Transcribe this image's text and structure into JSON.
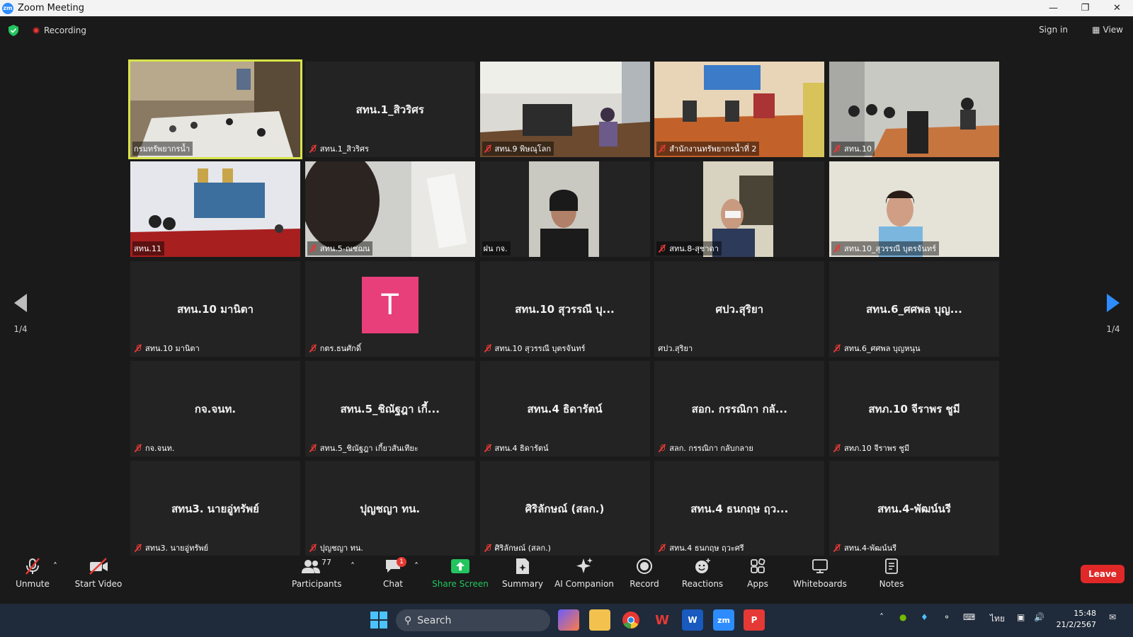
{
  "window": {
    "title": "Zoom Meeting",
    "controls": [
      "minimize",
      "restore",
      "close"
    ]
  },
  "meeting_bar": {
    "recording_label": "Recording",
    "sign_in": "Sign in",
    "view": "View"
  },
  "pagination": {
    "left": "1/4",
    "right": "1/4"
  },
  "tiles": [
    {
      "type": "video",
      "label": "กรมทรัพยากรน้ำ",
      "muted": false,
      "active": true,
      "scene": "room-wood"
    },
    {
      "type": "name",
      "center": "สทน.1_สิวริศร",
      "label": "สทน.1_สิวริศร",
      "muted": true
    },
    {
      "type": "video",
      "label": "สทน.9 พิษณุโลก",
      "muted": true,
      "scene": "office-white"
    },
    {
      "type": "video",
      "label": "สำนักงานทรัพยากรน้ำที่ 2",
      "muted": true,
      "scene": "room-orange"
    },
    {
      "type": "video",
      "label": "สทน.10",
      "muted": true,
      "scene": "room-grey"
    },
    {
      "type": "video",
      "label": "สทน.11",
      "muted": false,
      "scene": "room-red"
    },
    {
      "type": "video",
      "label": "สทน.5-ณชฌน",
      "muted": true,
      "scene": "closeup"
    },
    {
      "type": "video",
      "label": "ฝน กจ.",
      "muted": false,
      "scene": "portrait-narrow"
    },
    {
      "type": "video",
      "label": "สทน.8-สุชาดา",
      "muted": true,
      "scene": "portrait-window"
    },
    {
      "type": "video",
      "label": "สทน.10_สุวรรณี บุตรจันทร์",
      "muted": true,
      "scene": "portrait-blue"
    },
    {
      "type": "name",
      "center": "สทน.10 มานิตา",
      "label": "สทน.10 มานิตา",
      "muted": true
    },
    {
      "type": "avatar",
      "initial": "T",
      "label": "กตร.ธนศักดิ์",
      "muted": true
    },
    {
      "type": "name",
      "center": "สทน.10 สุวรรณี บุ...",
      "label": "สทน.10 สุวรรณี บุตรจันทร์",
      "muted": true
    },
    {
      "type": "name",
      "center": "ศปว.สุริยา",
      "label": "ศปว.สุริยา",
      "muted": false
    },
    {
      "type": "name",
      "center": "สทน.6_ศศพล บุญ...",
      "label": "สทน.6_ศศพล บุญหนุน",
      "muted": true
    },
    {
      "type": "name",
      "center": "กจ.จนท.",
      "label": "กจ.จนท.",
      "muted": true
    },
    {
      "type": "name",
      "center": "สทน.5_ชิณัฐฎา เกี้...",
      "label": "สทน.5_ชิณัฐฎา เกี้ยวสันเทียะ",
      "muted": true
    },
    {
      "type": "name",
      "center": "สทน.4 ธิดารัตน์",
      "label": "สทน.4 ธิดารัตน์",
      "muted": true
    },
    {
      "type": "name",
      "center": "สอก. กรรณิกา กลั...",
      "label": "สลก. กรรณิกา กลับกลาย",
      "muted": true
    },
    {
      "type": "name",
      "center": "สทภ.10 จีราพร ชูมี",
      "label": "สทภ.10 จีราพร ชูมี",
      "muted": true
    },
    {
      "type": "name",
      "center": "สทน3. นายอู่ทรัพย์",
      "label": "สทน3. นายอู่ทรัพย์",
      "muted": true
    },
    {
      "type": "name",
      "center": "ปุญชญา ทน.",
      "label": "ปุญชญา ทน.",
      "muted": true
    },
    {
      "type": "name",
      "center": "ศิริลักษณ์ (สลก.)",
      "label": "ศิริลักษณ์ (สลก.)",
      "muted": true
    },
    {
      "type": "name",
      "center": "สทน.4 ธนกฤษ ฤว...",
      "label": "สทน.4 ธนกฤษ ฤวะศรี",
      "muted": true
    },
    {
      "type": "name",
      "center": "สทน.4-พัฒน์นรี",
      "label": "สทน.4-พัฒน์นรี",
      "muted": true
    }
  ],
  "toolbar": {
    "unmute": "Unmute",
    "start_video": "Start Video",
    "participants": "Participants",
    "participants_count": "77",
    "chat": "Chat",
    "chat_badge": "1",
    "share_screen": "Share Screen",
    "summary": "Summary",
    "ai_companion": "AI Companion",
    "record": "Record",
    "reactions": "Reactions",
    "apps": "Apps",
    "whiteboards": "Whiteboards",
    "notes": "Notes",
    "leave": "Leave"
  },
  "taskbar": {
    "search_placeholder": "Search",
    "language": "ไทย",
    "time": "15:48",
    "date": "21/2/2567"
  },
  "colors": {
    "accent_green": "#22c55e",
    "leave_red": "#e02828",
    "active_speaker": "#d8e34a",
    "avatar_pink": "#e83e7a"
  }
}
